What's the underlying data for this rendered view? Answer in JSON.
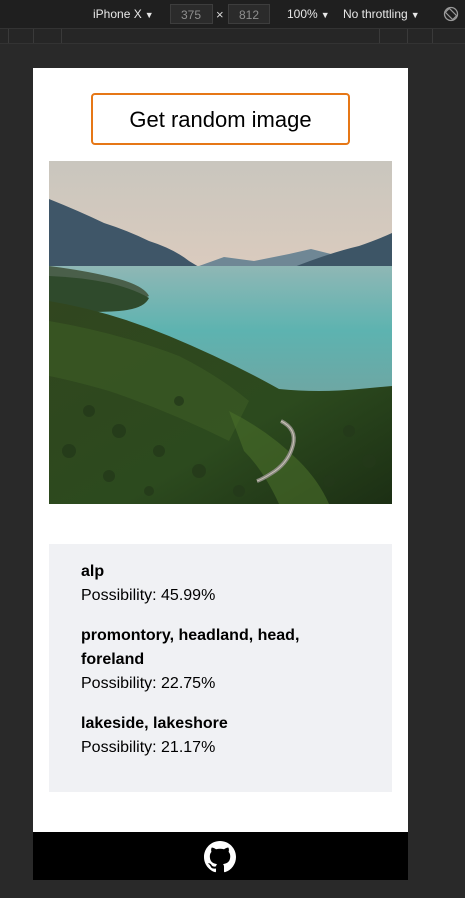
{
  "devtools": {
    "device": "iPhone X",
    "width_value": "375",
    "height_value": "812",
    "times_symbol": "×",
    "zoom": "100%",
    "throttling": "No throttling",
    "dropdown_arrow": "▼"
  },
  "app": {
    "button_label": "Get random image",
    "image_alt": "Aerial view of a forested mountainside beside a turquoise lake with a winding road",
    "predictions": [
      {
        "label": "alp",
        "possibility": "Possibility: 45.99%"
      },
      {
        "label": "promontory, headland, head, foreland",
        "possibility": "Possibility: 22.75%"
      },
      {
        "label": "lakeside, lakeshore",
        "possibility": "Possibility: 21.17%"
      }
    ]
  },
  "footer": {
    "icon": "github-icon"
  },
  "colors": {
    "button_border": "#e67716",
    "results_bg": "#f0f1f4",
    "footer_bg": "#000000"
  }
}
